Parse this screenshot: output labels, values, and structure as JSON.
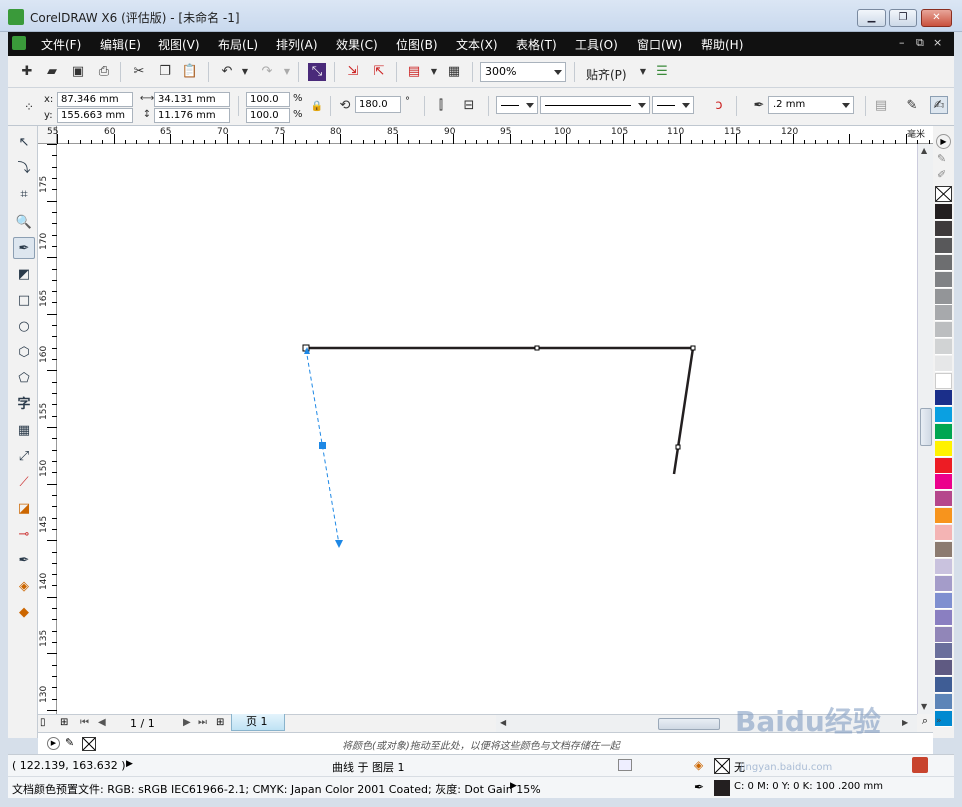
{
  "window": {
    "title": "CorelDRAW X6 (评估版) - [未命名 -1]",
    "controls": [
      "▁",
      "❐",
      "✕"
    ]
  },
  "menu": {
    "items": [
      "文件(F)",
      "编辑(E)",
      "视图(V)",
      "布局(L)",
      "排列(A)",
      "效果(C)",
      "位图(B)",
      "文本(X)",
      "表格(T)",
      "工具(O)",
      "窗口(W)",
      "帮助(H)"
    ],
    "doc_controls": [
      "–",
      "⧉",
      "×"
    ]
  },
  "toolbar": {
    "zoom_value": "300%",
    "snap_label": "贴齐(P)"
  },
  "properties": {
    "x_label": "x:",
    "x_value": "87.346 mm",
    "y_label": "y:",
    "y_value": "155.663 mm",
    "width_value": "34.131 mm",
    "height_value": "11.176 mm",
    "scale_x": "100.0",
    "scale_y": "100.0",
    "percent": "%",
    "rotation": "180.0",
    "degree": "°",
    "outline_width": ".2 mm"
  },
  "rulers": {
    "horizontal": [
      "55",
      "60",
      "65",
      "70",
      "75",
      "80",
      "85",
      "90",
      "95",
      "100",
      "105",
      "110",
      "115",
      "120"
    ],
    "h_unit": "毫米",
    "vertical": [
      "175",
      "170",
      "165",
      "160",
      "155",
      "150",
      "145",
      "140",
      "135",
      "130"
    ],
    "v_unit": "毫米"
  },
  "page_nav": {
    "counter": "1 / 1",
    "tab": "页 1"
  },
  "doc_palette": {
    "hint": "将颜色(或对象)拖动至此处，以便将这些颜色与文档存储在一起"
  },
  "status": {
    "coordinates": "( 122.139, 163.632 )",
    "object_info": "曲线 于 图层 1",
    "fill_none": "无",
    "color_profile": "文档颜色预置文件: RGB: sRGB IEC61966-2.1; CMYK: Japan Color 2001 Coated; 灰度: Dot Gain 15%",
    "outline_info": "C: 0 M: 0 Y: 0 K: 100  .200 mm"
  },
  "palette": {
    "swatches": [
      "#231f20",
      "#3e3a3b",
      "#58585a",
      "#6d6e70",
      "#808285",
      "#939598",
      "#a7a9ac",
      "#bcbec0",
      "#d1d3d4",
      "#e6e7e8",
      "#ffffff",
      "#1b2f8a",
      "#0aa0e1",
      "#00a651",
      "#fff200",
      "#ed1c24",
      "#ec008c",
      "#b5478c",
      "#f7941d",
      "#f4b4b4",
      "#8c7b70",
      "#c9c2de",
      "#a49cc9",
      "#7f8fd0",
      "#8a7fc1",
      "#9186b8",
      "#6a6f9c",
      "#5f5a82",
      "#3f5d95",
      "#5d85b8",
      "#0089d0"
    ]
  },
  "watermark": {
    "brand": "Baidu经验",
    "url": "jingyan.baidu.com"
  }
}
